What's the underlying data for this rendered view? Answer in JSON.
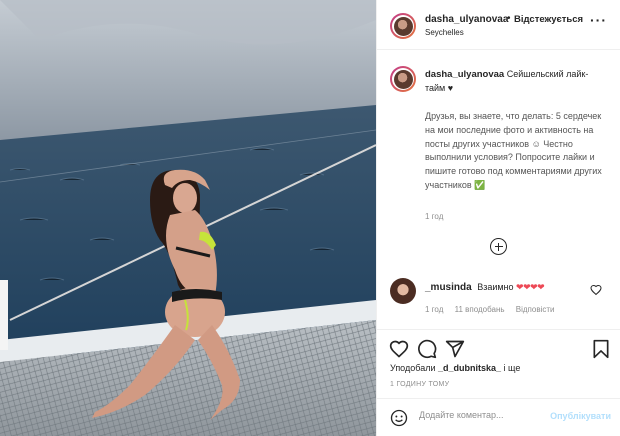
{
  "post": {
    "username": "dasha_ulyanovaa",
    "dot": "•",
    "follow_label": "Відстежується",
    "location": "Seychelles",
    "more_label": "···"
  },
  "caption": {
    "username": "dasha_ulyanovaa",
    "title": "Сейшельский лайк-тайм ♥",
    "body": "Друзья, вы знаете, что делать: 5 сердечек на мои последние фото и активность на посты других участников ☺ Честно выполнили условия? Попросите лайки и пишите готово под комментариями других участников ✅",
    "time": "1 год"
  },
  "comment": {
    "username": "_musinda",
    "text": "Взаимно",
    "hearts": "❤❤❤❤",
    "time": "1 год",
    "likes": "11 вподобань",
    "reply": "Відповісти"
  },
  "actions": {
    "liked_by_prefix": "Уподобали",
    "liked_by_user": "_d_dubnitska_",
    "liked_by_suffix": "і ще",
    "time": "1 ГОДИНУ ТОМУ"
  },
  "add_comment": {
    "placeholder": "Додайте коментар...",
    "publish_label": "Опублікувати"
  },
  "icons": {
    "more": "more-icon",
    "load_more": "plus-circle-icon",
    "like": "heart-icon",
    "comment": "comment-icon",
    "share": "share-icon",
    "save": "bookmark-icon",
    "emoji": "emoji-icon"
  },
  "colors": {
    "text": "#262626",
    "muted": "#8e8e8e",
    "heart": "#ed4956",
    "publish_disabled": "#b2dffc",
    "border": "#efefef"
  }
}
